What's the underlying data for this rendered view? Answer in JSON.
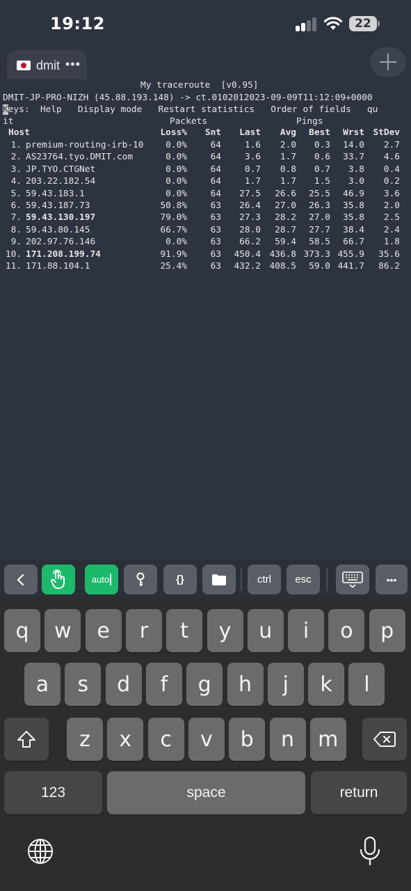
{
  "status": {
    "time": "19:12",
    "battery": "22"
  },
  "tab": {
    "label": "dmit",
    "more": "•••",
    "flag": "japan-flag"
  },
  "terminal": {
    "title": "My traceroute  [v0.95]",
    "route": "DMIT-JP-PRO-NIZH (45.88.193.148) -> ct.0102012023-09-09T11:12:09+0000",
    "keys_k": "K",
    "keys_rest": "eys:  Help   Display mode   Restart statistics   Order of fields   qu",
    "keys_wrap": "it",
    "group_packets": "Packets",
    "group_pings": "Pings",
    "columns": [
      "Host",
      "Loss%",
      "Snt",
      "Last",
      "Avg",
      "Best",
      "Wrst",
      "StDev"
    ],
    "rows": [
      {
        "num": "1.",
        "host": "premium-routing-irb-10",
        "loss": "0.0%",
        "snt": "64",
        "last": "1.6",
        "avg": "2.0",
        "best": "0.3",
        "wrst": "14.0",
        "stdev": "2.7",
        "bold": false
      },
      {
        "num": "2.",
        "host": "AS23764.tyo.DMIT.com",
        "loss": "0.0%",
        "snt": "64",
        "last": "3.6",
        "avg": "1.7",
        "best": "0.6",
        "wrst": "33.7",
        "stdev": "4.6",
        "bold": false
      },
      {
        "num": "3.",
        "host": "JP.TYO.CTGNet",
        "loss": "0.0%",
        "snt": "64",
        "last": "0.7",
        "avg": "0.8",
        "best": "0.7",
        "wrst": "3.8",
        "stdev": "0.4",
        "bold": false
      },
      {
        "num": "4.",
        "host": "203.22.182.54",
        "loss": "0.0%",
        "snt": "64",
        "last": "1.7",
        "avg": "1.7",
        "best": "1.5",
        "wrst": "3.0",
        "stdev": "0.2",
        "bold": false
      },
      {
        "num": "5.",
        "host": "59.43.183.1",
        "loss": "0.0%",
        "snt": "64",
        "last": "27.5",
        "avg": "26.6",
        "best": "25.5",
        "wrst": "46.9",
        "stdev": "3.6",
        "bold": false
      },
      {
        "num": "6.",
        "host": "59.43.187.73",
        "loss": "50.8%",
        "snt": "63",
        "last": "26.4",
        "avg": "27.0",
        "best": "26.3",
        "wrst": "35.8",
        "stdev": "2.0",
        "bold": false
      },
      {
        "num": "7.",
        "host": "59.43.130.197",
        "loss": "79.0%",
        "snt": "63",
        "last": "27.3",
        "avg": "28.2",
        "best": "27.0",
        "wrst": "35.8",
        "stdev": "2.5",
        "bold": true
      },
      {
        "num": "8.",
        "host": "59.43.80.145",
        "loss": "66.7%",
        "snt": "63",
        "last": "28.0",
        "avg": "28.7",
        "best": "27.7",
        "wrst": "38.4",
        "stdev": "2.4",
        "bold": false
      },
      {
        "num": "9.",
        "host": "202.97.76.146",
        "loss": "0.0%",
        "snt": "63",
        "last": "66.2",
        "avg": "59.4",
        "best": "58.5",
        "wrst": "66.7",
        "stdev": "1.8",
        "bold": false
      },
      {
        "num": "10.",
        "host": "171.208.199.74",
        "loss": "91.9%",
        "snt": "63",
        "last": "450.4",
        "avg": "436.8",
        "best": "373.3",
        "wrst": "455.9",
        "stdev": "35.6",
        "bold": true
      },
      {
        "num": "11.",
        "host": "171.88.104.1",
        "loss": "25.4%",
        "snt": "63",
        "last": "432.2",
        "avg": "408.5",
        "best": "59.0",
        "wrst": "441.7",
        "stdev": "86.2",
        "bold": false
      }
    ]
  },
  "toolbar": {
    "auto_label": "auto",
    "braces_label": "{}",
    "ctrl_label": "ctrl",
    "esc_label": "esc",
    "more_label": "•••",
    "accent": "#1db96b"
  },
  "keyboard": {
    "row1": [
      "q",
      "w",
      "e",
      "r",
      "t",
      "y",
      "u",
      "i",
      "o",
      "p"
    ],
    "row2": [
      "a",
      "s",
      "d",
      "f",
      "g",
      "h",
      "j",
      "k",
      "l"
    ],
    "row3": [
      "z",
      "x",
      "c",
      "v",
      "b",
      "n",
      "m"
    ],
    "numbers_label": "123",
    "space_label": "space",
    "return_label": "return"
  }
}
